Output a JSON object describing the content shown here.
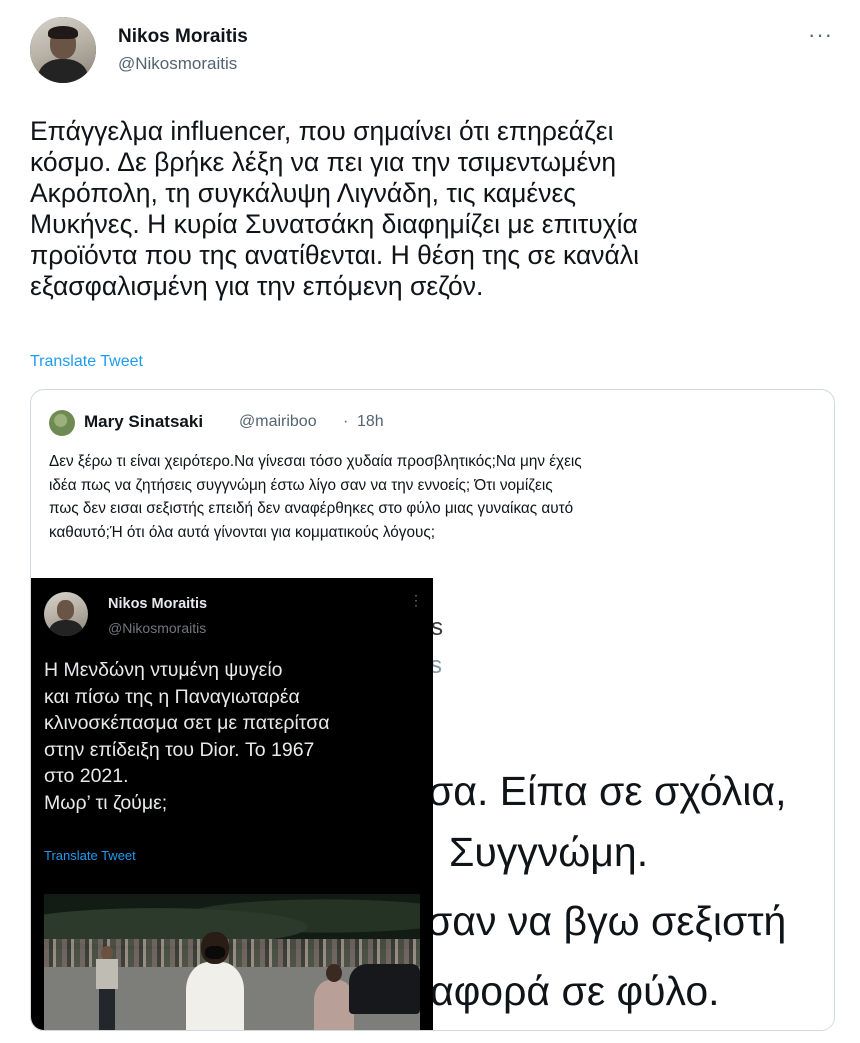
{
  "author": {
    "name": "Nikos Moraitis",
    "handle": "@Nikosmoraitis"
  },
  "more_label": "···",
  "tweet_text": "Επάγγελμα influencer, που σημαίνει ότι επηρεάζει\nκόσμο. Δε βρήκε λέξη να πει για την τσιμεντωμένη\nΑκρόπολη, τη συγκάλυψη Λιγνάδη, τις καμένες\nΜυκήνες. Η κυρία Συνατσάκη διαφημίζει με επιτυχία\nπροϊόντα που της ανατίθενται. Η θέση της σε κανάλι\nεξασφαλισμένη για την επόμενη σεζόν.",
  "translate_label": "Translate Tweet",
  "quote": {
    "name": "Mary Sinatsaki",
    "handle": "@mairiboo",
    "dot": "·",
    "time": "18h",
    "text": "Δεν ξέρω τι είναι χειρότερο.Να γίνεσαι τόσο χυδαία προσβλητικός;Να μην έχεις\nιδέα πως να ζητήσεις συγγνώμη έστω λίγο σαν να την εννοείς; Ότι νομίζεις\nπως δεν εισαι σεξιστής επειδή δεν αναφέρθηκες στο φύλο μιας γυναίκας αυτό\nκαθαυτό;Ή ότι όλα αυτά γίνονται για κομματικούς λόγους;"
  },
  "embedded": {
    "name": "Nikos Moraitis",
    "handle": "@Nikosmoraitis",
    "dots": "⋮",
    "text": "Η Μενδώνη ντυμένη ψυγείο\nκαι πίσω της η Παναγιωταρέα\nκλινοσκέπασμα σετ με πατερίτσα\nστην επίδειξη του Dior. Το 1967\nστο 2021.\nΜωρ’ τι ζούμε;",
    "translate_label": "Translate Tweet",
    "fragments": {
      "s": "s",
      "s2": "s",
      "line1": "σα. Είπα σε σχόλια,",
      "line2": "Συγγνώμη.",
      "line3": "σαν να βγω σεξιστή",
      "line4": "αφορά σε φύλο."
    }
  }
}
